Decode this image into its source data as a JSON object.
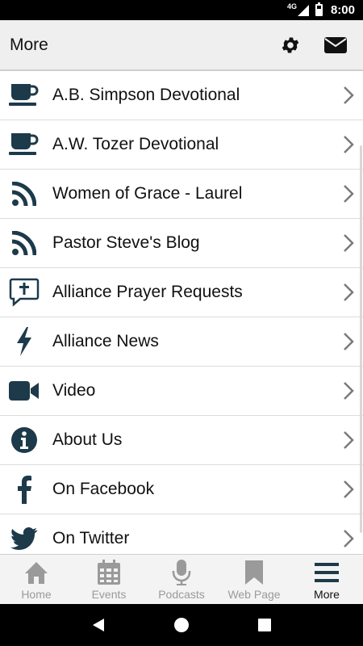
{
  "status_bar": {
    "network": "4G",
    "time": "8:00"
  },
  "app_bar": {
    "title": "More"
  },
  "colors": {
    "icon": "#1d3a4a",
    "inactive": "#9a9a9a",
    "chevron": "#7a7a7a"
  },
  "list": {
    "items": [
      {
        "label": "A.B. Simpson Devotional",
        "icon": "coffee-cup-icon"
      },
      {
        "label": "A.W. Tozer Devotional",
        "icon": "coffee-cup-icon"
      },
      {
        "label": "Women of Grace - Laurel",
        "icon": "rss-icon"
      },
      {
        "label": "Pastor Steve's Blog",
        "icon": "rss-icon"
      },
      {
        "label": "Alliance Prayer Requests",
        "icon": "prayer-cross-icon"
      },
      {
        "label": "Alliance News",
        "icon": "lightning-icon"
      },
      {
        "label": "Video",
        "icon": "video-camera-icon"
      },
      {
        "label": "About Us",
        "icon": "info-icon"
      },
      {
        "label": "On Facebook",
        "icon": "facebook-icon"
      },
      {
        "label": "On Twitter",
        "icon": "twitter-icon"
      }
    ]
  },
  "tabs": [
    {
      "label": "Home",
      "icon": "home-icon"
    },
    {
      "label": "Events",
      "icon": "calendar-icon"
    },
    {
      "label": "Podcasts",
      "icon": "microphone-icon"
    },
    {
      "label": "Web Page",
      "icon": "bookmark-icon"
    },
    {
      "label": "More",
      "icon": "menu-icon",
      "active": true
    }
  ]
}
